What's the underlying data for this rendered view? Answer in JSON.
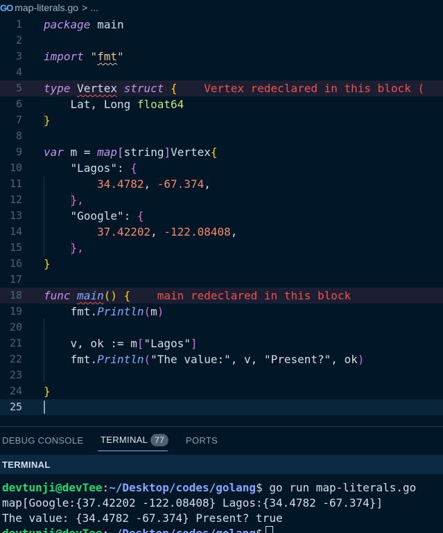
{
  "breadcrumb": {
    "file": "map-literals.go",
    "ellipsis": "...",
    "chevron": ">"
  },
  "editor": {
    "line_numbers": [
      "1",
      "2",
      "3",
      "4",
      "5",
      "6",
      "7",
      "8",
      "9",
      "10",
      "11",
      "12",
      "13",
      "14",
      "15",
      "16",
      "17",
      "18",
      "19",
      "20",
      "21",
      "22",
      "23",
      "24",
      "25"
    ],
    "code": {
      "l1_kw": "package",
      "l1_name": "main",
      "l3_kw": "import",
      "l3_str_open": "\"",
      "l3_str_name": "fmt",
      "l3_str_close": "\"",
      "l5_kw": "type",
      "l5_name": "Vertex",
      "l5_kw2": "struct",
      "l5_brace": "{",
      "l5_error": "Vertex redeclared in this block (",
      "l6_fields": "Lat, Long",
      "l6_type": "float64",
      "l7_brace": "}",
      "l9_kw": "var",
      "l9_var": "m",
      "l9_eq": "=",
      "l9_map": "map",
      "l9_lb": "[",
      "l9_key": "string",
      "l9_rb": "]",
      "l9_val": "Vertex",
      "l9_brace": "{",
      "l10_key": "\"Lagos\"",
      "l10_colon": ":",
      "l10_brace": "{",
      "l11_n1": "34.4782",
      "l11_comma": ",",
      "l11_n2": "-67.374",
      "l11_comma2": ",",
      "l12_close": "},",
      "l13_key": "\"Google\"",
      "l13_colon": ":",
      "l13_brace": "{",
      "l14_n1": "37.42202",
      "l14_comma": ",",
      "l14_n2": "-122.08408",
      "l14_comma2": ",",
      "l15_close": "},",
      "l16_brace": "}",
      "l18_kw": "func",
      "l18_name": "main",
      "l18_parens": "()",
      "l18_brace": "{",
      "l18_error": "main redeclared in this block",
      "l19_pkg": "fmt",
      "l19_dot": ".",
      "l19_fn": "Println",
      "l19_lp": "(",
      "l19_arg": "m",
      "l19_rp": ")",
      "l21_lhs": "v, ok",
      "l21_op": ":=",
      "l21_m": "m",
      "l21_lb": "[",
      "l21_key": "\"Lagos\"",
      "l21_rb": "]",
      "l22_pkg": "fmt",
      "l22_dot": ".",
      "l22_fn": "Println",
      "l22_lp": "(",
      "l22_s1": "\"The value:\"",
      "l22_c1": ",",
      "l22_v": "v",
      "l22_c2": ",",
      "l22_s2": "\"Present?\"",
      "l22_c3": ",",
      "l22_ok": "ok",
      "l22_rp": ")",
      "l24_brace": "}"
    }
  },
  "panel": {
    "tabs": {
      "debug_console": "DEBUG CONSOLE",
      "terminal": "TERMINAL",
      "terminal_badge": "77",
      "ports": "PORTS"
    },
    "section_title": "TERMINAL"
  },
  "terminal": {
    "prompt_user": "devtunji@devTee",
    "prompt_sep": ":",
    "prompt_path": "~/Desktop/codes/golang",
    "prompt_end": "$",
    "command": "go run map-literals.go",
    "output_1": "map[Google:{37.42202 -122.08408} Lagos:{34.4782 -67.374}]",
    "output_2": "The value: {34.4782 -67.374} Present? true"
  },
  "colors": {
    "background": "#011627",
    "error": "#ef5350",
    "keyword": "#c792ea",
    "string": "#ecc48d",
    "number": "#f78c6c",
    "prompt_user": "#22da6e",
    "prompt_path": "#82aaff"
  },
  "icons": {
    "breadcrumb_file_icon": "go-file-icon",
    "breadcrumb_separator": "chevron-right-icon"
  }
}
